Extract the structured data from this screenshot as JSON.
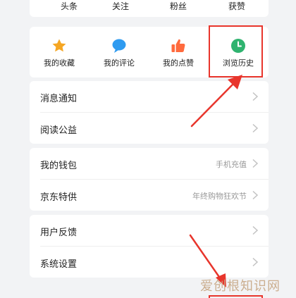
{
  "stats": [
    "头条",
    "关注",
    "粉丝",
    "获赞"
  ],
  "quick_actions": [
    {
      "label": "我的收藏",
      "icon": "star-icon",
      "color": "#f5a623"
    },
    {
      "label": "我的评论",
      "icon": "comment-icon",
      "color": "#2f9bf0"
    },
    {
      "label": "我的点赞",
      "icon": "thumbs-up-icon",
      "color": "#ff6a3d"
    },
    {
      "label": "浏览历史",
      "icon": "clock-icon",
      "color": "#2fb36f"
    }
  ],
  "section1": [
    {
      "label": "消息通知",
      "hint": ""
    },
    {
      "label": "阅读公益",
      "hint": ""
    }
  ],
  "section2": [
    {
      "label": "我的钱包",
      "hint": "手机充值"
    },
    {
      "label": "京东特供",
      "hint": "年终购物狂欢节"
    }
  ],
  "section3": [
    {
      "label": "用户反馈",
      "hint": ""
    },
    {
      "label": "系统设置",
      "hint": ""
    }
  ],
  "watermark": "爱创根知识网",
  "accent": "#e8352c"
}
